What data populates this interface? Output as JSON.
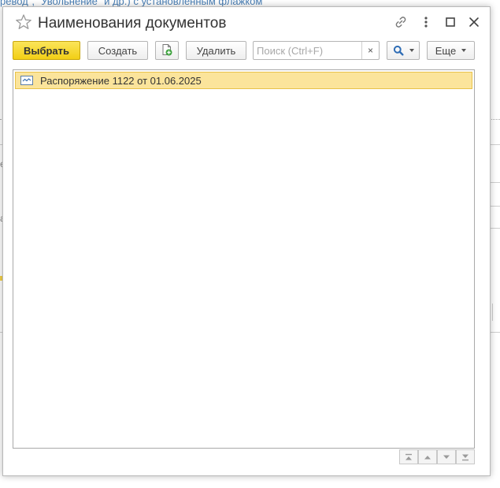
{
  "background": {
    "link_text": "ревод\", \"Увольнение\" и др.) с установленным флажком",
    "fragment_a": "е",
    "fragment_b": "а"
  },
  "window": {
    "title": "Наименования документов",
    "icons": [
      "star-icon",
      "link-icon",
      "more-icon",
      "maximize-icon",
      "close-icon"
    ]
  },
  "toolbar": {
    "select_label": "Выбрать",
    "create_label": "Создать",
    "copy_icon": "document-add-icon",
    "delete_label": "Удалить",
    "search_placeholder": "Поиск (Ctrl+F)",
    "search_value": "",
    "clear_symbol": "×",
    "search_icon": "search-icon",
    "more_label": "Еще"
  },
  "list": {
    "items": [
      {
        "label": "Распоряжение 1122 от 01.06.2025",
        "icon": "catalog-item-icon",
        "selected": true
      }
    ]
  },
  "navigation": [
    "first-page-icon",
    "previous-page-icon",
    "next-page-icon",
    "last-page-icon"
  ],
  "colors": {
    "primary_button": "#f2cf15",
    "selected_row": "#fbe49b",
    "selected_row_border": "#e8c24a",
    "accent_blue": "#3a6fb0"
  }
}
